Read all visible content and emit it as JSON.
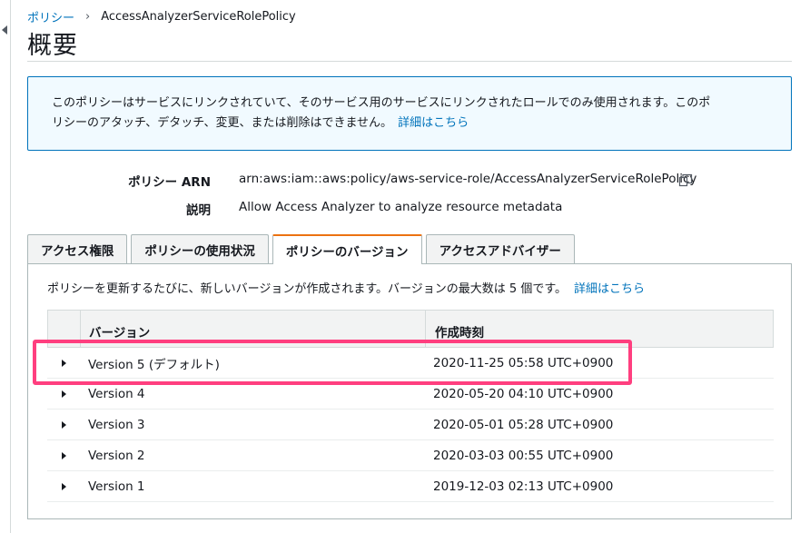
{
  "breadcrumb": {
    "parent": "ポリシー",
    "current": "AccessAnalyzerServiceRolePolicy"
  },
  "page": {
    "title": "概要"
  },
  "info": {
    "text_line1": "このポリシーはサービスにリンクされていて、そのサービス用のサービスにリンクされたロールでのみ使用されます。このポ",
    "text_line2": "リシーのアタッチ、デタッチ、変更、または削除はできません。",
    "link": "詳細はこちら"
  },
  "meta": {
    "arn_label": "ポリシー ARN",
    "arn_value": "arn:aws:iam::aws:policy/aws-service-role/AccessAnalyzerServiceRolePolicy",
    "description_label": "説明",
    "description_value": "Allow Access Analyzer to analyze resource metadata",
    "copy_icon": "copy-icon"
  },
  "tabs": [
    {
      "label": "アクセス権限",
      "active": false
    },
    {
      "label": "ポリシーの使用状況",
      "active": false
    },
    {
      "label": "ポリシーのバージョン",
      "active": true
    },
    {
      "label": "アクセスアドバイザー",
      "active": false
    }
  ],
  "versions_panel": {
    "description": "ポリシーを更新するたびに、新しいバージョンが作成されます。バージョンの最大数は 5 個です。",
    "link": "詳細はこちら",
    "columns": [
      "バージョン",
      "作成時刻"
    ],
    "rows": [
      {
        "version": "Version 5 (デフォルト)",
        "created": "2020-11-25 05:58 UTC+0900"
      },
      {
        "version": "Version 4",
        "created": "2020-05-20 04:10 UTC+0900"
      },
      {
        "version": "Version 3",
        "created": "2020-05-01 05:28 UTC+0900"
      },
      {
        "version": "Version 2",
        "created": "2020-03-03 00:55 UTC+0900"
      },
      {
        "version": "Version 1",
        "created": "2019-12-03 02:13 UTC+0900"
      }
    ]
  },
  "colors": {
    "link": "#0073bb",
    "active_tab": "#ec7211",
    "highlight": "#ff3f7f",
    "info_bg": "#f1faff"
  }
}
